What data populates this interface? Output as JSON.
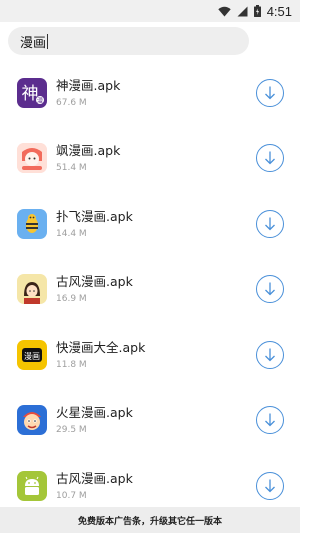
{
  "status_bar": {
    "time": "4:51",
    "icons": [
      "wifi-icon",
      "signal-icon",
      "battery-icon"
    ]
  },
  "search": {
    "value": "漫画",
    "placeholder": ""
  },
  "results": [
    {
      "name": "神漫画.apk",
      "size": "67.6 M",
      "icon": "shen-manhua-app-icon",
      "color": "#5b2d8e"
    },
    {
      "name": "飒漫画.apk",
      "size": "51.4 M",
      "icon": "sa-manhua-app-icon",
      "color": "#f26b5b"
    },
    {
      "name": "扑飞漫画.apk",
      "size": "14.4 M",
      "icon": "pufei-manhua-app-icon",
      "color": "#6ab0f0"
    },
    {
      "name": "古风漫画.apk",
      "size": "16.9 M",
      "icon": "gufeng-manhua-app-icon",
      "color": "#f5e6a8"
    },
    {
      "name": "快漫画大全.apk",
      "size": "11.8 M",
      "icon": "kuai-manhua-app-icon",
      "color": "#f5c400"
    },
    {
      "name": "火星漫画.apk",
      "size": "29.5 M",
      "icon": "huoxing-manhua-app-icon",
      "color": "#2c6fd6"
    },
    {
      "name": "古风漫画.apk",
      "size": "10.7 M",
      "icon": "android-app-icon",
      "color": "#a4c639"
    }
  ],
  "download_icon": "download-icon",
  "download_color": "#4a90d9",
  "ad_bar": {
    "text": "免费版本广告条，升级其它任一版本"
  }
}
